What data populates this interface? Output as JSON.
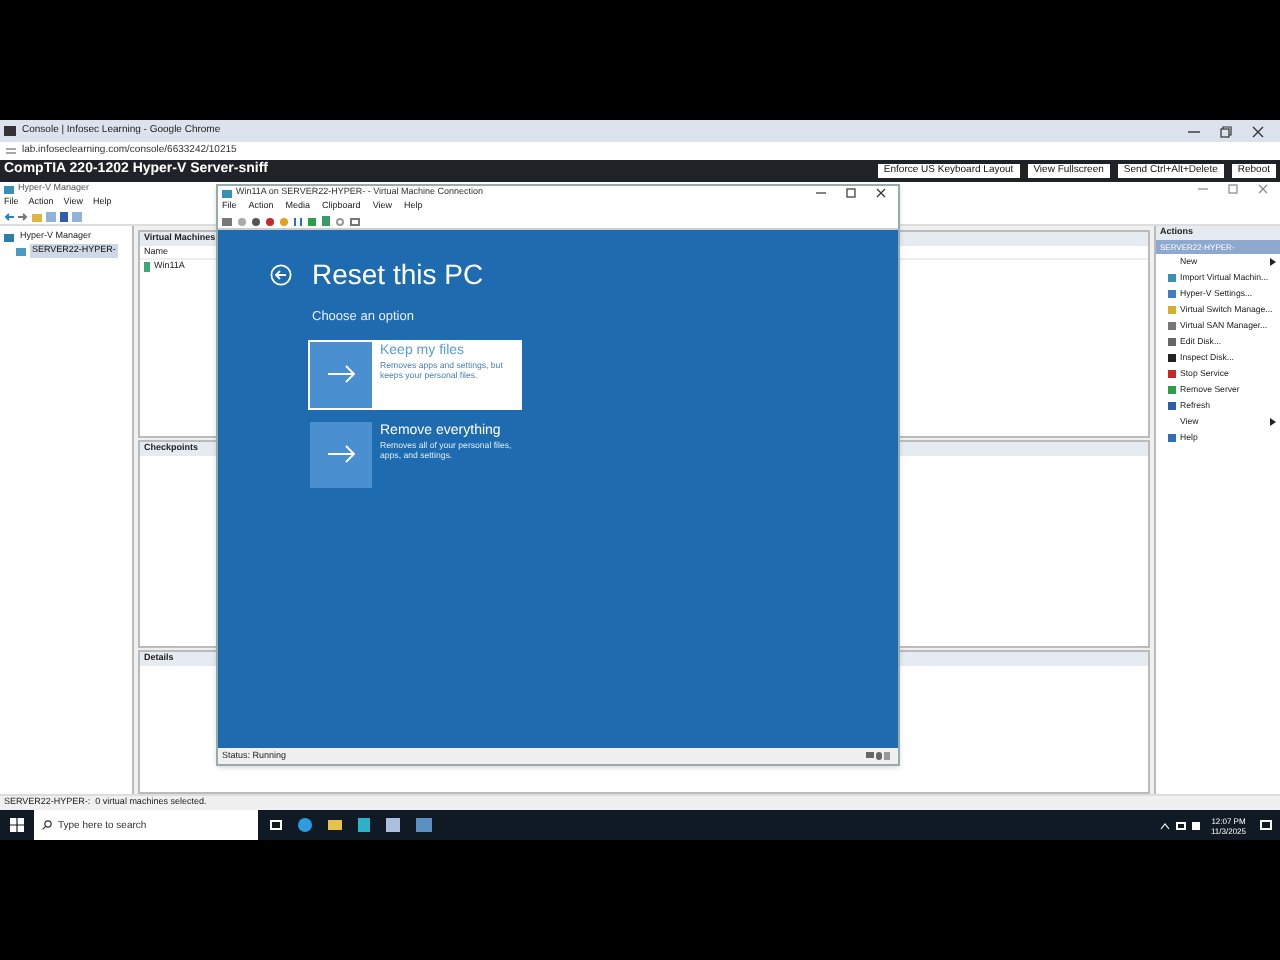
{
  "browser": {
    "title": "Console | Infosec Learning - Google Chrome",
    "url": "lab.infoseclearning.com/console/6633242/10215"
  },
  "lab_bar": {
    "title": "CompTIA 220-1202 Hyper-V Server-sniff",
    "buttons": [
      "Enforce US Keyboard Layout",
      "View Fullscreen",
      "Send Ctrl+Alt+Delete",
      "Reboot"
    ]
  },
  "hyperv": {
    "title": "Hyper-V Manager",
    "menu": [
      "File",
      "Action",
      "View",
      "Help"
    ],
    "tree": [
      {
        "label": "Hyper-V Manager",
        "selected": false,
        "children": [
          {
            "label": "SERVER22-HYPER-",
            "selected": true
          }
        ]
      }
    ],
    "vm_panel": {
      "title": "Virtual Machines",
      "columns": [
        "Name"
      ],
      "rows": [
        {
          "name": "Win11A",
          "selected": false
        }
      ]
    },
    "checkpoints": {
      "title": "Checkpoints"
    },
    "details": {
      "title": "Details"
    },
    "actions": {
      "title": "Actions",
      "group": "SERVER22-HYPER-",
      "items": [
        {
          "label": "New",
          "submenu": true
        },
        {
          "label": "Import Virtual Machin...",
          "submenu": false
        },
        {
          "label": "Hyper-V Settings...",
          "submenu": false
        },
        {
          "label": "Virtual Switch Manage...",
          "submenu": false
        },
        {
          "label": "Virtual SAN Manager...",
          "submenu": false
        },
        {
          "label": "Edit Disk...",
          "submenu": false
        },
        {
          "label": "Inspect Disk...",
          "submenu": false
        },
        {
          "label": "Stop Service",
          "submenu": false
        },
        {
          "label": "Remove Server",
          "submenu": false
        },
        {
          "label": "Refresh",
          "submenu": false
        },
        {
          "label": "View",
          "submenu": true
        },
        {
          "label": "Help",
          "submenu": false
        }
      ]
    },
    "status": "SERVER22-HYPER-:  0 virtual machines selected."
  },
  "vm_window": {
    "title": "Win11A on SERVER22-HYPER- - Virtual Machine Connection",
    "menu": [
      "File",
      "Action",
      "Media",
      "Clipboard",
      "View",
      "Help"
    ],
    "content": {
      "title": "Reset this PC",
      "subtitle": "Choose an option",
      "options": [
        {
          "title": "Keep my files",
          "description": "Removes apps and settings, but keeps your personal files.",
          "selected": true
        },
        {
          "title": "Remove everything",
          "description": "Removes all of your personal files, apps, and settings.",
          "selected": false
        }
      ]
    },
    "status": "Status: Running"
  },
  "taskbar": {
    "search_placeholder": "Type here to search",
    "time": "12:07 PM",
    "date": "11/3/2025"
  }
}
